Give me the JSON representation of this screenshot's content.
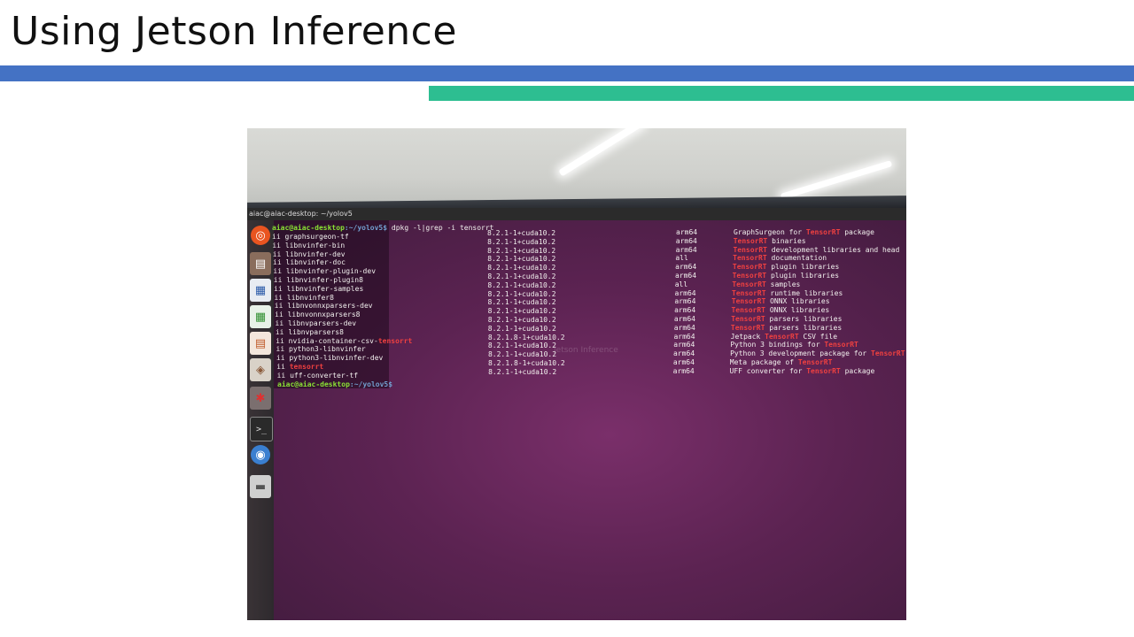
{
  "slide": {
    "title": "Using Jetson Inference"
  },
  "terminal": {
    "window_title": "aiac@aiac-desktop: ~/yolov5",
    "command_user": "aiac@aiac-desktop",
    "command_path": ":~/yolov5$",
    "command": " dpkg -l|grep -i tensorrt",
    "rows": [
      {
        "status": "ii",
        "name": "graphsurgeon-tf",
        "version": "8.2.1-1+cuda10.2",
        "arch": "arm64",
        "desc_pre": "GraphSurgeon for ",
        "desc_hl": "TensorRT",
        "desc_post": " package"
      },
      {
        "status": "ii",
        "name": "libnvinfer-bin",
        "version": "8.2.1-1+cuda10.2",
        "arch": "arm64",
        "desc_pre": "",
        "desc_hl": "TensorRT",
        "desc_post": " binaries"
      },
      {
        "status": "ii",
        "name": "libnvinfer-dev",
        "version": "8.2.1-1+cuda10.2",
        "arch": "arm64",
        "desc_pre": "",
        "desc_hl": "TensorRT",
        "desc_post": " development libraries and head"
      },
      {
        "status": "ii",
        "name": "libnvinfer-doc",
        "version": "8.2.1-1+cuda10.2",
        "arch": "all",
        "desc_pre": "",
        "desc_hl": "TensorRT",
        "desc_post": " documentation"
      },
      {
        "status": "ii",
        "name": "libnvinfer-plugin-dev",
        "version": "8.2.1-1+cuda10.2",
        "arch": "arm64",
        "desc_pre": "",
        "desc_hl": "TensorRT",
        "desc_post": " plugin libraries"
      },
      {
        "status": "ii",
        "name": "libnvinfer-plugin8",
        "version": "8.2.1-1+cuda10.2",
        "arch": "arm64",
        "desc_pre": "",
        "desc_hl": "TensorRT",
        "desc_post": " plugin libraries"
      },
      {
        "status": "ii",
        "name": "libnvinfer-samples",
        "version": "8.2.1-1+cuda10.2",
        "arch": "all",
        "desc_pre": "",
        "desc_hl": "TensorRT",
        "desc_post": " samples"
      },
      {
        "status": "ii",
        "name": "libnvinfer8",
        "version": "8.2.1-1+cuda10.2",
        "arch": "arm64",
        "desc_pre": "",
        "desc_hl": "TensorRT",
        "desc_post": " runtime libraries"
      },
      {
        "status": "ii",
        "name": "libnvonnxparsers-dev",
        "version": "8.2.1-1+cuda10.2",
        "arch": "arm64",
        "desc_pre": "",
        "desc_hl": "TensorRT",
        "desc_post": " ONNX libraries"
      },
      {
        "status": "ii",
        "name": "libnvonnxparsers8",
        "version": "8.2.1-1+cuda10.2",
        "arch": "arm64",
        "desc_pre": "",
        "desc_hl": "TensorRT",
        "desc_post": " ONNX libraries"
      },
      {
        "status": "ii",
        "name": "libnvparsers-dev",
        "version": "8.2.1-1+cuda10.2",
        "arch": "arm64",
        "desc_pre": "",
        "desc_hl": "TensorRT",
        "desc_post": " parsers libraries"
      },
      {
        "status": "ii",
        "name": "libnvparsers8",
        "version": "8.2.1-1+cuda10.2",
        "arch": "arm64",
        "desc_pre": "",
        "desc_hl": "TensorRT",
        "desc_post": " parsers libraries"
      },
      {
        "status": "ii",
        "name_pre": "nvidia-container-csv-",
        "name_hl": "tensorrt",
        "version": "8.2.1.8-1+cuda10.2",
        "arch": "arm64",
        "desc_pre": "Jetpack ",
        "desc_hl": "TensorRT",
        "desc_post": " CSV file"
      },
      {
        "status": "ii",
        "name": "python3-libnvinfer",
        "version": "8.2.1-1+cuda10.2",
        "arch": "arm64",
        "desc_pre": "Python 3 bindings for ",
        "desc_hl": "TensorRT",
        "desc_post": ""
      },
      {
        "status": "ii",
        "name": "python3-libnvinfer-dev",
        "version": "8.2.1-1+cuda10.2",
        "arch": "arm64",
        "desc_pre": "Python 3 development package for ",
        "desc_hl": "TensorRT",
        "desc_post": ""
      },
      {
        "status": "ii",
        "name_pre": "",
        "name_hl": "tensorrt",
        "version": "8.2.1.8-1+cuda10.2",
        "arch": "arm64",
        "desc_pre": "Meta package of ",
        "desc_hl": "TensorRT",
        "desc_post": ""
      },
      {
        "status": "ii",
        "name": "uff-converter-tf",
        "version": "8.2.1-1+cuda10.2",
        "arch": "arm64",
        "desc_pre": "UFF converter for ",
        "desc_hl": "TensorRT",
        "desc_post": " package"
      }
    ],
    "end_user": "aiac@aiac-desktop",
    "end_path": ":~/yolov5$"
  },
  "launcher": {
    "icons": [
      "ubuntu-icon",
      "files-icon",
      "writer-icon",
      "calc-icon",
      "impress-icon",
      "software-icon",
      "settings-icon",
      "terminal-icon",
      "chromium-icon",
      "drive-icon"
    ]
  },
  "colors": {
    "accent_blue": "#4472c4",
    "accent_green": "#2dbe91",
    "highlight_red": "#ef4040",
    "prompt_green": "#8ae234",
    "prompt_blue": "#729fcf"
  }
}
